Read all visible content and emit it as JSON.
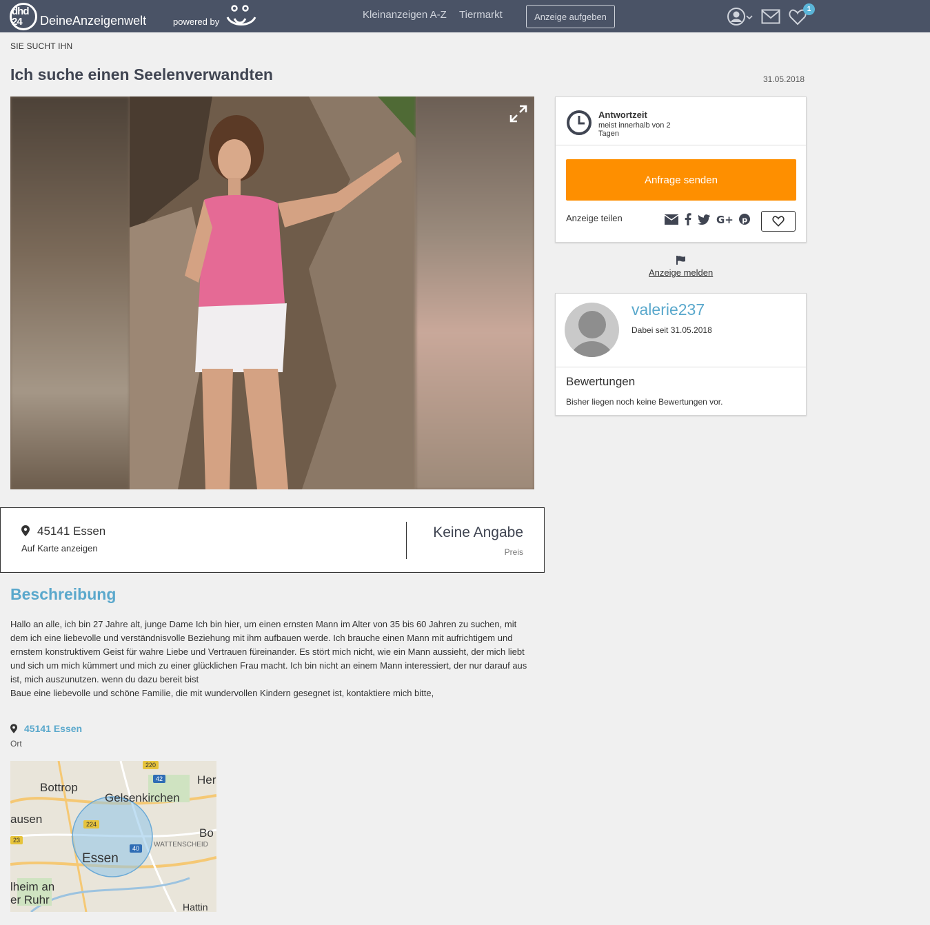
{
  "header": {
    "logo_badge": "dhd 24",
    "logo_text": "DeineAnzeigenwelt",
    "powered_by": "powered by",
    "nav": [
      "Kleinanzeigen A-Z",
      "Tiermarkt"
    ],
    "post_button": "Anzeige aufgeben",
    "favorites_count": "1",
    "icons": [
      "user-icon",
      "mail-icon",
      "heart-icon"
    ]
  },
  "listing": {
    "category": "SIE SUCHT IHN",
    "title": "Ich suche einen Seelenverwandten",
    "date": "31.05.2018",
    "location": "45141 Essen",
    "map_link": "Auf Karte anzeigen",
    "price": "Keine Angabe",
    "price_label": "Preis",
    "description_heading": "Beschreibung",
    "description_lines": [
      "Hallo an alle, ich bin 27 Jahre alt, junge Dame Ich bin hier, um einen ernsten Mann im Alter von 35 bis 60 Jahren zu suchen, mit",
      "dem ich eine liebevolle und verständnisvolle Beziehung mit ihm aufbauen werde. Ich brauche einen Mann mit aufrichtigem und",
      "ernstem konstruktivem Geist für wahre Liebe und Vertrauen füreinander. Es stört mich nicht, wie ein Mann aussieht, der mich liebt",
      "und sich um mich kümmert und mich zu einer glücklichen Frau macht. Ich bin nicht an einem Mann interessiert, der nur darauf aus",
      "ist, mich auszunutzen. wenn du dazu bereit bist",
      "Baue eine liebevolle und schöne Familie, die mit wundervollen Kindern gesegnet ist, kontaktiere mich bitte,"
    ],
    "ort_city": "45141 Essen",
    "ort_label": "Ort"
  },
  "map": {
    "labels": [
      "Bottrop",
      "Gelsenkirchen",
      "Her",
      "ausen",
      "Bo",
      "Essen",
      "WATTENSCHEID",
      "lheim an",
      "er Ruhr",
      "Hattin"
    ],
    "roads": [
      "224",
      "42",
      "40",
      "23",
      "220"
    ]
  },
  "contact_card": {
    "response_title": "Antwortzeit",
    "response_text": "meist innerhalb von 2 Tagen",
    "send_button": "Anfrage senden",
    "share_label": "Anzeige teilen",
    "share_icons": [
      "mail-icon",
      "facebook-icon",
      "twitter-icon",
      "google-plus-icon",
      "pinterest-icon"
    ]
  },
  "report": {
    "label": "Anzeige melden"
  },
  "user_card": {
    "username": "valerie237",
    "member_since": "Dabei seit 31.05.2018",
    "ratings_heading": "Bewertungen",
    "ratings_text": "Bisher liegen noch keine Bewertungen vor."
  },
  "colors": {
    "header_bg": "#4a5366",
    "accent_blue": "#5aa8cc",
    "send_button": "#fe8f00"
  }
}
